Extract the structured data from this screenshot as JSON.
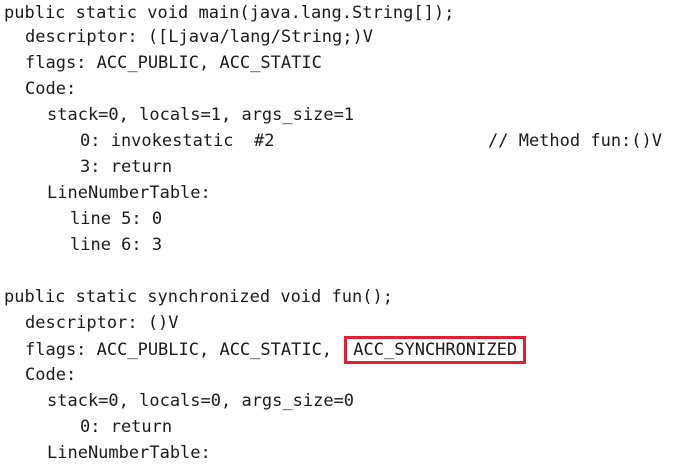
{
  "lines": {
    "main_sig": "public static void main(java.lang.String[]);",
    "main_descriptor": "descriptor: ([Ljava/lang/String;)V",
    "main_flags": "flags: ACC_PUBLIC, ACC_STATIC",
    "main_code": "Code:",
    "main_stack": "stack=0, locals=1, args_size=1",
    "main_instr0": "0: invokestatic  #2",
    "main_instr0_comment": "// Method fun:()V",
    "main_instr3": "3: return",
    "main_lnt": "LineNumberTable:",
    "main_line5": "line 5: 0",
    "main_line6": "line 6: 3",
    "fun_sig": "public static synchronized void fun();",
    "fun_descriptor": "descriptor: ()V",
    "fun_flags_prefix": "flags: ACC_PUBLIC, ACC_STATIC,",
    "fun_flags_highlight": "ACC_SYNCHRONIZED",
    "fun_code": "Code:",
    "fun_stack": "stack=0, locals=0, args_size=0",
    "fun_instr0": "0: return",
    "fun_lnt": "LineNumberTable:"
  },
  "colors": {
    "highlight_border": "#e02030",
    "text": "#1a1a1a",
    "background": "#ffffff"
  }
}
